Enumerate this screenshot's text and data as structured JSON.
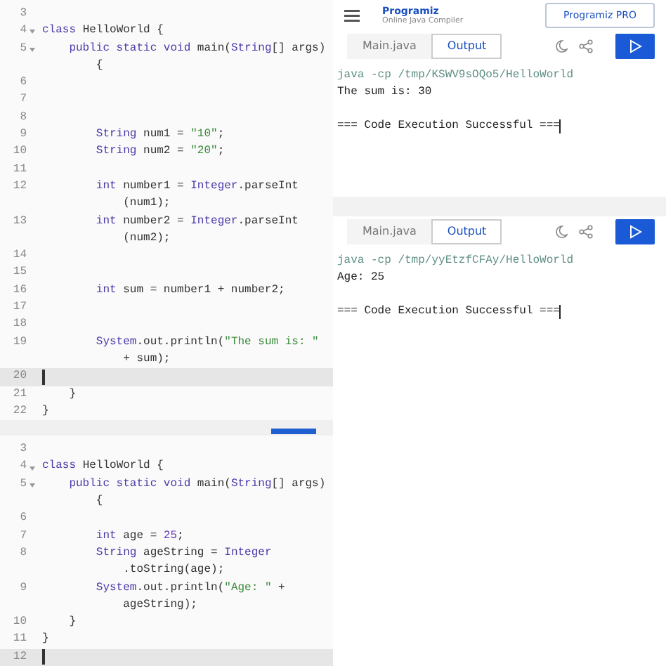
{
  "editors": [
    {
      "lines": [
        {
          "number": "3"
        },
        {
          "number": "4",
          "fold": true,
          "segments": [
            {
              "text": "class",
              "kind": "keyword"
            },
            {
              "text": " HelloWorld {",
              "kind": "plain"
            }
          ]
        },
        {
          "number": "5",
          "fold": true,
          "segments": [
            {
              "text": "    public static void",
              "kind": "keyword"
            },
            {
              "text": " main(",
              "kind": "plain"
            },
            {
              "text": "String",
              "kind": "keyword"
            },
            {
              "text": "[] args)",
              "kind": "plain"
            }
          ],
          "continuation": "        {"
        },
        {
          "number": "6"
        },
        {
          "number": "7"
        },
        {
          "number": "8"
        },
        {
          "number": "9",
          "segments": [
            {
              "text": "        String",
              "kind": "keyword"
            },
            {
              "text": " num1 = ",
              "kind": "plain"
            },
            {
              "text": "\"10\"",
              "kind": "string"
            },
            {
              "text": ";",
              "kind": "plain"
            }
          ]
        },
        {
          "number": "10",
          "segments": [
            {
              "text": "        String",
              "kind": "keyword"
            },
            {
              "text": " num2 = ",
              "kind": "plain"
            },
            {
              "text": "\"20\"",
              "kind": "string"
            },
            {
              "text": ";",
              "kind": "plain"
            }
          ]
        },
        {
          "number": "11"
        },
        {
          "number": "12",
          "segments": [
            {
              "text": "        int",
              "kind": "keyword"
            },
            {
              "text": " number1 = ",
              "kind": "plain"
            },
            {
              "text": "Integer",
              "kind": "keyword"
            },
            {
              "text": ".parseInt",
              "kind": "plain"
            }
          ],
          "continuation": "            (num1);"
        },
        {
          "number": "13",
          "segments": [
            {
              "text": "        int",
              "kind": "keyword"
            },
            {
              "text": " number2 = ",
              "kind": "plain"
            },
            {
              "text": "Integer",
              "kind": "keyword"
            },
            {
              "text": ".parseInt",
              "kind": "plain"
            }
          ],
          "continuation": "            (num2);"
        },
        {
          "number": "14"
        },
        {
          "number": "15"
        },
        {
          "number": "16",
          "segments": [
            {
              "text": "        int",
              "kind": "keyword"
            },
            {
              "text": " sum = number1 + number2;",
              "kind": "plain"
            }
          ]
        },
        {
          "number": "17"
        },
        {
          "number": "18"
        },
        {
          "number": "19",
          "segments": [
            {
              "text": "        System",
              "kind": "keyword"
            },
            {
              "text": ".out.println(",
              "kind": "plain"
            },
            {
              "text": "\"The sum is: \"",
              "kind": "string"
            }
          ],
          "continuation": "            + sum);"
        },
        {
          "number": "20",
          "active": true
        },
        {
          "number": "21",
          "segments": [
            {
              "text": "    }",
              "kind": "plain"
            }
          ]
        },
        {
          "number": "22",
          "segments": [
            {
              "text": "}",
              "kind": "plain"
            }
          ]
        }
      ]
    },
    {
      "lines": [
        {
          "number": "3"
        },
        {
          "number": "4",
          "fold": true,
          "segments": [
            {
              "text": "class",
              "kind": "keyword"
            },
            {
              "text": " HelloWorld {",
              "kind": "plain"
            }
          ]
        },
        {
          "number": "5",
          "fold": true,
          "segments": [
            {
              "text": "    public static void",
              "kind": "keyword"
            },
            {
              "text": " main(",
              "kind": "plain"
            },
            {
              "text": "String",
              "kind": "keyword"
            },
            {
              "text": "[] args)",
              "kind": "plain"
            }
          ],
          "continuation": "        {"
        },
        {
          "number": "6"
        },
        {
          "number": "7",
          "segments": [
            {
              "text": "        int",
              "kind": "keyword"
            },
            {
              "text": " age = ",
              "kind": "plain"
            },
            {
              "text": "25",
              "kind": "number"
            },
            {
              "text": ";",
              "kind": "plain"
            }
          ]
        },
        {
          "number": "8",
          "segments": [
            {
              "text": "        String",
              "kind": "keyword"
            },
            {
              "text": " ageString = ",
              "kind": "plain"
            },
            {
              "text": "Integer",
              "kind": "keyword"
            }
          ],
          "continuation": "            .toString(age);"
        },
        {
          "number": "9",
          "segments": [
            {
              "text": "        System",
              "kind": "keyword"
            },
            {
              "text": ".out.println(",
              "kind": "plain"
            },
            {
              "text": "\"Age: \"",
              "kind": "string"
            },
            {
              "text": " +",
              "kind": "plain"
            }
          ],
          "continuation": "            ageString);"
        },
        {
          "number": "10",
          "segments": [
            {
              "text": "    }",
              "kind": "plain"
            }
          ]
        },
        {
          "number": "11",
          "segments": [
            {
              "text": "}",
              "kind": "plain"
            }
          ]
        },
        {
          "number": "12",
          "active": true
        }
      ]
    }
  ],
  "compiler_panels": [
    {
      "header": {
        "logo": "Programiz",
        "subtitle": "Online Java Compiler",
        "pro_button": "Programiz PRO"
      },
      "tabs": [
        {
          "label": "Main.java",
          "selected": false
        },
        {
          "label": "Output",
          "selected": true
        }
      ],
      "output": [
        {
          "text": "java -cp /tmp/KSWV9sOQo5/HelloWorld",
          "kind": "command"
        },
        {
          "text": "The sum is: 30",
          "kind": "result"
        },
        {
          "kind": "blank"
        },
        {
          "text": "=== Code Execution Successful ===",
          "kind": "result",
          "cursor": true
        }
      ]
    },
    {
      "tabs": [
        {
          "label": "Main.java",
          "selected": false
        },
        {
          "label": "Output",
          "selected": true
        }
      ],
      "output": [
        {
          "text": "java -cp /tmp/yyEtzfCFAy/HelloWorld",
          "kind": "command"
        },
        {
          "text": "Age: 25",
          "kind": "result"
        },
        {
          "kind": "blank"
        },
        {
          "text": "=== Code Execution Successful ===",
          "kind": "result",
          "cursor": true
        }
      ]
    }
  ]
}
